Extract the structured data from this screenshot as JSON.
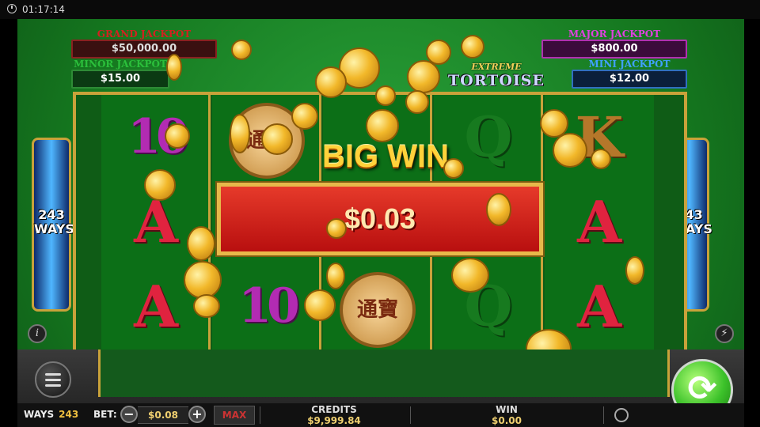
{
  "status": {
    "time": "01:17:14"
  },
  "jackpots": {
    "grand": {
      "label": "GRAND JACKPOT",
      "value": "$50,000.00"
    },
    "minor": {
      "label": "MINOR JACKPOT",
      "value": "$15.00"
    },
    "major": {
      "label": "MAJOR JACKPOT",
      "value": "$800.00"
    },
    "mini": {
      "label": "MINI JACKPOT",
      "value": "$12.00"
    }
  },
  "logo": {
    "line1": "EXTREME",
    "line2": "TORTOISE"
  },
  "ways_badge": {
    "number": "243",
    "word": "WAYS"
  },
  "reels": [
    [
      "10",
      "A",
      "A"
    ],
    [
      "coin",
      "",
      "10"
    ],
    [
      "",
      "",
      "coin"
    ],
    [
      "Q",
      "",
      "Q"
    ],
    [
      "K",
      "A",
      "A"
    ]
  ],
  "coin_symbol_text": "通寶",
  "big_win": {
    "title": "BIG WIN",
    "amount": "$0.03"
  },
  "controls": {
    "ways_label": "WAYS",
    "ways_value": "243",
    "bet_label": "BET:",
    "bet_value": "$0.08",
    "max_label": "MAX",
    "credits_label": "CREDITS",
    "credits_value": "$9,999.84",
    "win_label": "WIN",
    "win_value": "$0.00",
    "info_glyph": "i",
    "minus_glyph": "−",
    "plus_glyph": "+",
    "spin_glyph": "⟳"
  },
  "colors": {
    "felt": "#1a8a2a",
    "gold": "#c9a23a",
    "win_red": "#c81414",
    "spin_green": "#3cc22a"
  }
}
